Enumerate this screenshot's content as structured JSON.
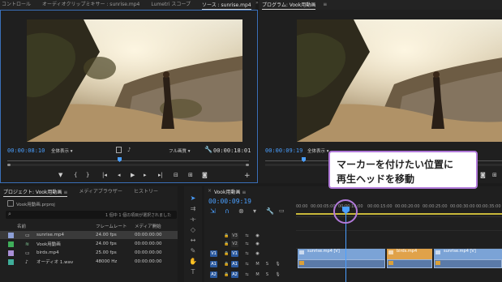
{
  "source_tabs": {
    "effect_controls": "コントロール",
    "audio_clip_mixer": "オーディオクリップミキサー : sunrise.mp4",
    "lumetri": "Lumetri スコープ",
    "source": "ソース : sunrise.mp4",
    "menu": "≡"
  },
  "program_tabs": {
    "program": "プログラム: Vook用動画",
    "menu": "≡"
  },
  "source_monitor": {
    "timecode_in": "00:00:08:10",
    "fit": "全体表示",
    "quality": "フル画質",
    "timecode_dur": "00:00:18:01"
  },
  "program_monitor": {
    "timecode": "00:00:09:19",
    "fit": "全体表示"
  },
  "project_panel": {
    "tab_project": "プロジェクト: Vook用動画",
    "tab_browser": "メディアブラウザー",
    "tab_history": "ヒストリー",
    "project_file": "Vook用動画.prproj",
    "selection_info": "1 個中 1 個の項目が選択されました",
    "col_name": "名前",
    "col_framerate": "フレームレート",
    "col_mediastart": "メディア開始",
    "rows": [
      {
        "name": "sunrise.mp4",
        "fps": "24.00 fps",
        "start": "00:00:00:00",
        "color": "#8d9fd6"
      },
      {
        "name": "Vook用動画",
        "fps": "24.00 fps",
        "start": "00:00:00:00",
        "color": "#3fae5a"
      },
      {
        "name": "birds.mp4",
        "fps": "25.00 fps",
        "start": "00:00:00:00",
        "color": "#a98fd6"
      },
      {
        "name": "オーディオ 1.wav",
        "fps": "48000 Hz",
        "start": "00:00:00:00",
        "color": "#3fae9a"
      }
    ]
  },
  "timeline": {
    "tab": "Vook用動画",
    "timecode": "00:00:09:19",
    "ruler": [
      "00:00",
      "00:00:05:00",
      "00:00:10:00",
      "00:00:15:00",
      "00:00:20:00",
      "00:00:25:00",
      "00:00:30:00",
      "00:00:35:00",
      "00:00:40:00"
    ],
    "tracks": [
      {
        "label": "V3",
        "src": ""
      },
      {
        "label": "V2",
        "src": ""
      },
      {
        "label": "V1",
        "src": "V1"
      },
      {
        "label": "A1",
        "src": "A1"
      },
      {
        "label": "A2",
        "src": "A2"
      }
    ],
    "clips": [
      {
        "name": "sunrise.mp4 [V]"
      },
      {
        "name": "birds.mp4"
      },
      {
        "name": "sunrise.mp4 [V]"
      }
    ],
    "mute": "M",
    "solo": "S"
  },
  "annotation": {
    "line1": "マーカーを付けたい位置に",
    "line2": "再生ヘッドを移動"
  },
  "colors": {
    "accent_blue": "#4a9fff",
    "annotation_purple": "#b17ad9",
    "clip_video": "#7ba3d6",
    "clip_orange": "#e0a24a"
  }
}
